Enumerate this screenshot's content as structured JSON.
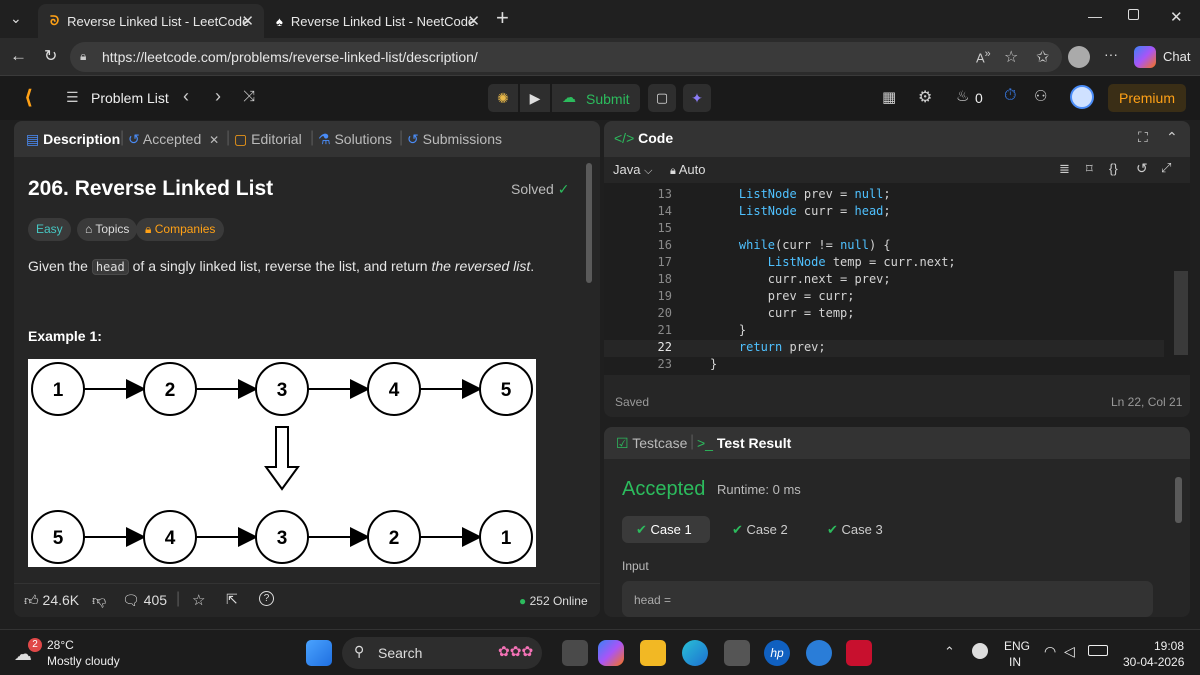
{
  "browser": {
    "tabs": [
      {
        "title": "Reverse Linked List - LeetCode",
        "active": true
      },
      {
        "title": "Reverse Linked List - NeetCode",
        "active": false
      }
    ],
    "new_tab": "+",
    "url": "https://leetcode.com/problems/reverse-linked-list/description/",
    "chat_label": "Chat"
  },
  "nav": {
    "problem_list": "Problem List",
    "submit": "Submit",
    "streak": "0",
    "premium": "Premium"
  },
  "left_panel": {
    "tabs": [
      {
        "label": "Description"
      },
      {
        "label": "Accepted"
      },
      {
        "label": "Editorial"
      },
      {
        "label": "Solutions"
      },
      {
        "label": "Submissions"
      }
    ],
    "title": "206. Reverse Linked List",
    "solved": "Solved",
    "tags": {
      "difficulty": "Easy",
      "topics": "Topics",
      "companies": "Companies"
    },
    "desc_before": "Given the",
    "desc_code": "head",
    "desc_mid": "of a singly linked list, reverse the list, and return",
    "desc_em": "the reversed list",
    "desc_end": ".",
    "example_label": "Example 1:",
    "diagram": {
      "top_nodes": [
        "1",
        "2",
        "3",
        "4",
        "5"
      ],
      "bottom_nodes": [
        "5",
        "4",
        "3",
        "2",
        "1"
      ]
    },
    "footer": {
      "likes": "24.6K",
      "comments": "405",
      "online": "252 Online"
    }
  },
  "code_panel": {
    "title": "Code",
    "language": "Java",
    "mode": "Auto",
    "lines": [
      {
        "n": "13",
        "text": "    ListNode prev = null;"
      },
      {
        "n": "14",
        "text": "    ListNode curr = head;"
      },
      {
        "n": "15",
        "text": ""
      },
      {
        "n": "16",
        "text": "    while(curr != null) {"
      },
      {
        "n": "17",
        "text": "        ListNode temp = curr.next;"
      },
      {
        "n": "18",
        "text": "        curr.next = prev;"
      },
      {
        "n": "19",
        "text": "        prev = curr;"
      },
      {
        "n": "20",
        "text": "        curr = temp;"
      },
      {
        "n": "21",
        "text": "    }"
      },
      {
        "n": "22",
        "text": "    return prev;"
      },
      {
        "n": "23",
        "text": "}"
      }
    ],
    "status": "Saved",
    "cursor": "Ln 22, Col 21"
  },
  "result_panel": {
    "tab_testcase": "Testcase",
    "tab_result": "Test Result",
    "verdict": "Accepted",
    "runtime": "Runtime: 0 ms",
    "cases": [
      "Case 1",
      "Case 2",
      "Case 3"
    ],
    "input_label": "Input",
    "input_value": "head ="
  },
  "taskbar": {
    "weather_badge": "2",
    "temp": "28°C",
    "weather": "Mostly cloudy",
    "search": "Search",
    "lang1": "ENG",
    "lang2": "IN",
    "time": "19:08",
    "date": "30-04-2026"
  },
  "colors": {
    "accent_green": "#2cbb5d",
    "easy": "#46c6c2",
    "premium": "#ffa116",
    "code_blue": "#4fc1ff"
  }
}
